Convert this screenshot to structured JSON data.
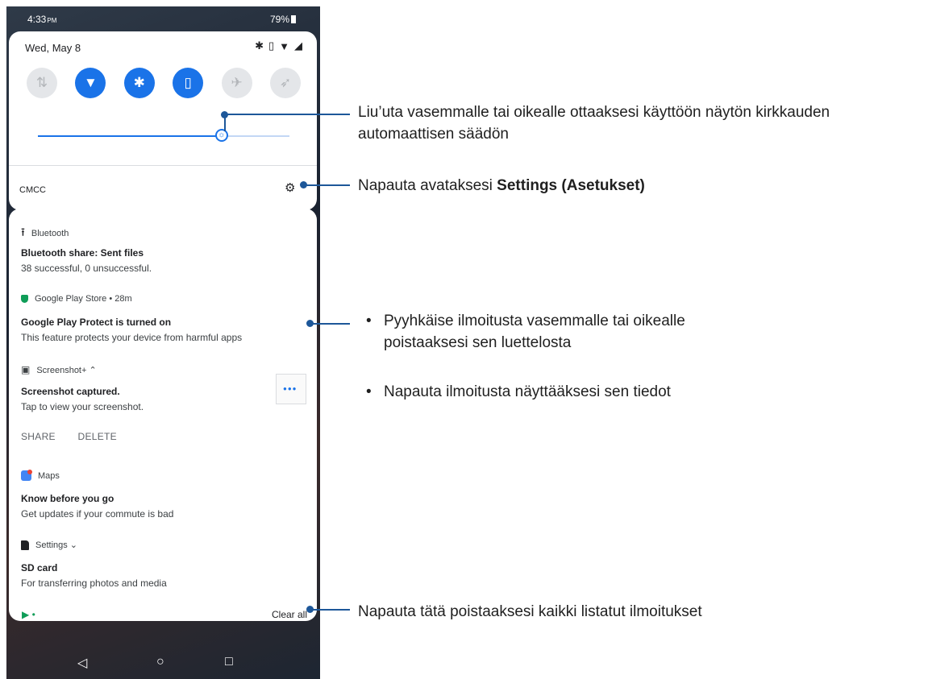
{
  "status_bar": {
    "time": "4:33",
    "ampm": "PM",
    "battery": "79%"
  },
  "quick_settings": {
    "date": "Wed, May 8",
    "status_icons": [
      "bluetooth-icon",
      "vibrate-icon",
      "wifi-icon",
      "signal-icon"
    ],
    "tiles": [
      {
        "name": "data",
        "icon": "⇅",
        "on": false
      },
      {
        "name": "wifi",
        "icon": "▼",
        "on": true
      },
      {
        "name": "bluetooth",
        "icon": "✱",
        "on": true
      },
      {
        "name": "vibrate",
        "icon": "▯",
        "on": true
      },
      {
        "name": "airplane",
        "icon": "✈",
        "on": false
      },
      {
        "name": "rocket",
        "icon": "➶",
        "on": false
      }
    ],
    "brightness_fraction": 0.73,
    "carrier": "CMCC"
  },
  "notifications": {
    "bluetooth": {
      "app": "Bluetooth",
      "title": "Bluetooth share: Sent files",
      "body": "38 successful, 0 unsuccessful."
    },
    "playstore": {
      "app": "Google Play Store • 28m",
      "title": "Google Play Protect is turned on",
      "body": "This feature protects your device from harmful apps"
    },
    "screenshot": {
      "app": "Screenshot+ ⌃",
      "title": "Screenshot captured.",
      "body": "Tap to view your screenshot.",
      "actions": [
        "SHARE",
        "DELETE"
      ]
    },
    "maps": {
      "app": "Maps",
      "title": "Know before you go",
      "body": "Get updates if your commute is bad"
    },
    "settings": {
      "app": "Settings ⌄",
      "title": "SD card",
      "body": "For transferring photos and media"
    },
    "clear_all": "Clear all"
  },
  "callouts": {
    "brightness": "Liu’uta vasemmalle tai oikealle ottaaksesi käyttöön näytön kirkkauden automaattisen säädön",
    "settings_prefix": "Napauta avataksesi ",
    "settings_bold": "Settings (Asetukset)",
    "swipe": "Pyyhkäise ilmoitusta vasemmalle tai oikealle poistaaksesi sen luettelosta",
    "tap": "Napauta ilmoitusta näyttääksesi sen tiedot",
    "clear_all": "Napauta tätä poistaaksesi kaikki listatut ilmoitukset"
  },
  "colors": {
    "accent": "#1a73e8",
    "callout": "#1d5799"
  }
}
